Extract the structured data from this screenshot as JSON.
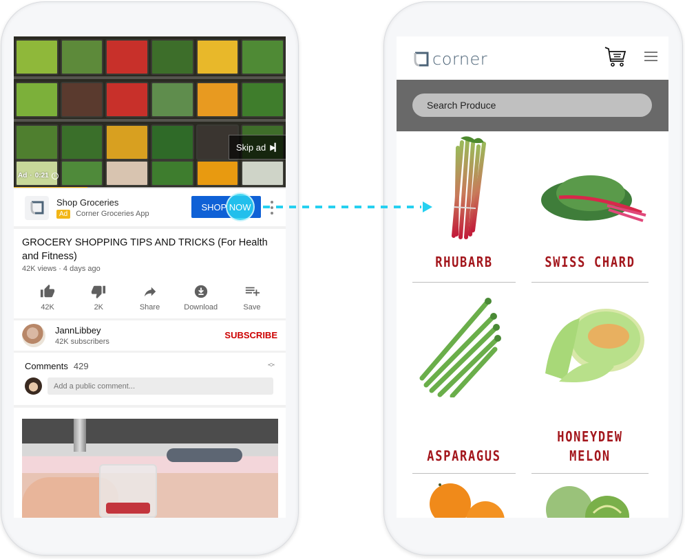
{
  "left_phone": {
    "video_ad": {
      "skip_label": "Skip ad",
      "skip_icon": "skip-next-icon",
      "ad_label": "Ad",
      "separator": "·",
      "time_remaining": "0:21",
      "info_icon": "info-icon",
      "progress_fraction": 0.27,
      "colors": {
        "progress": "#f2b617"
      }
    },
    "ad_bar": {
      "advertiser_title": "Shop Groceries",
      "badge": "Ad",
      "advertiser_subtitle": "Corner Groceries App",
      "cta_label": "SHOP NOW",
      "more_icon": "more-vertical-icon",
      "colors": {
        "cta": "#0f61d6",
        "badge": "#f2b617",
        "touch": "#26d0f0"
      }
    },
    "video_info": {
      "title": "GROCERY SHOPPING TIPS AND TRICKS (For Health and Fitness)",
      "meta": "42K views · 4 days ago",
      "actions": [
        {
          "icon": "thumbs-up-icon",
          "label": "42K"
        },
        {
          "icon": "thumbs-down-icon",
          "label": "2K"
        },
        {
          "icon": "share-icon",
          "label": "Share"
        },
        {
          "icon": "download-icon",
          "label": "Download"
        },
        {
          "icon": "add-to-playlist-icon",
          "label": "Save"
        }
      ]
    },
    "channel": {
      "name": "JannLibbey",
      "subscribers": "42K subscribers",
      "subscribe_label": "SUBSCRIBE",
      "colors": {
        "subscribe": "#cc0000"
      }
    },
    "comments": {
      "label": "Comments",
      "count": "429",
      "sort_icon": "expand-collapse-icon",
      "input_placeholder": "Add a public comment..."
    }
  },
  "flow_arrow": {
    "color": "#26d0f0"
  },
  "right_phone": {
    "header": {
      "brand_name": "corner",
      "cart_icon": "shopping-cart-icon",
      "menu_icon": "hamburger-menu-icon",
      "colors": {
        "brand": "#4d6478"
      }
    },
    "search": {
      "placeholder": "Search Produce"
    },
    "products": [
      {
        "name": "RHUBARB"
      },
      {
        "name": "SWISS CHARD"
      },
      {
        "name": "ASPARAGUS"
      },
      {
        "name": "HONEYDEW MELON"
      },
      {
        "name": ""
      },
      {
        "name": ""
      }
    ],
    "colors": {
      "product_name": "#a3161c",
      "search_band": "#696969"
    }
  }
}
